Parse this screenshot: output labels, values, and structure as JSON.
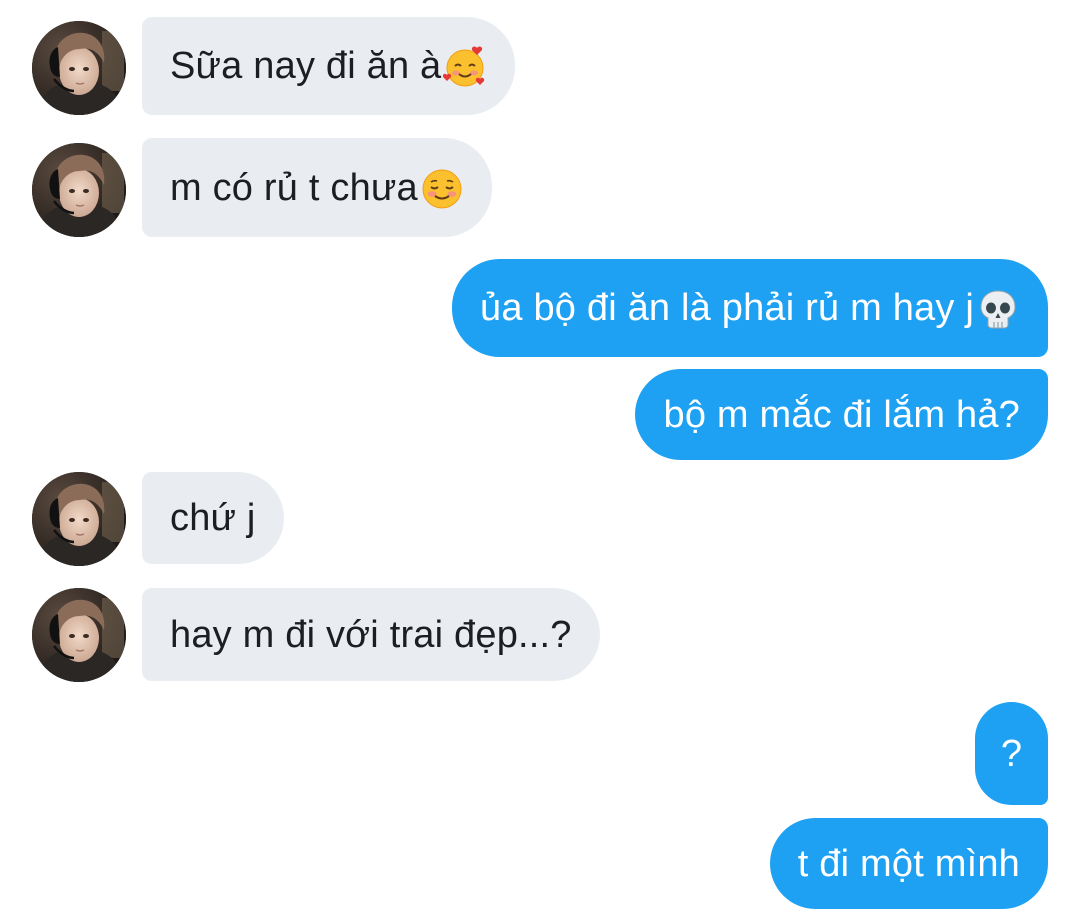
{
  "conversation": {
    "messages": [
      {
        "sender": "them",
        "text": "Sữa nay đi ăn à",
        "emoji": "smiling-face-with-hearts"
      },
      {
        "sender": "them",
        "text": "m có rủ t chưa",
        "emoji": "smiling-face"
      },
      {
        "sender": "me",
        "text": "ủa bộ đi ăn là phải rủ m hay j",
        "emoji": "skull"
      },
      {
        "sender": "me",
        "text": "bộ m mắc đi lắm hả?"
      },
      {
        "sender": "them",
        "text": "chứ j"
      },
      {
        "sender": "them",
        "text": "hay m đi với trai đẹp...?"
      },
      {
        "sender": "me",
        "text": "?"
      },
      {
        "sender": "me",
        "text": "t đi một mình"
      }
    ]
  },
  "colors": {
    "incoming_bubble": "#e9edf1",
    "outgoing_bubble": "#1ea1f2",
    "incoming_text": "#1c1e21",
    "outgoing_text": "#ffffff"
  }
}
